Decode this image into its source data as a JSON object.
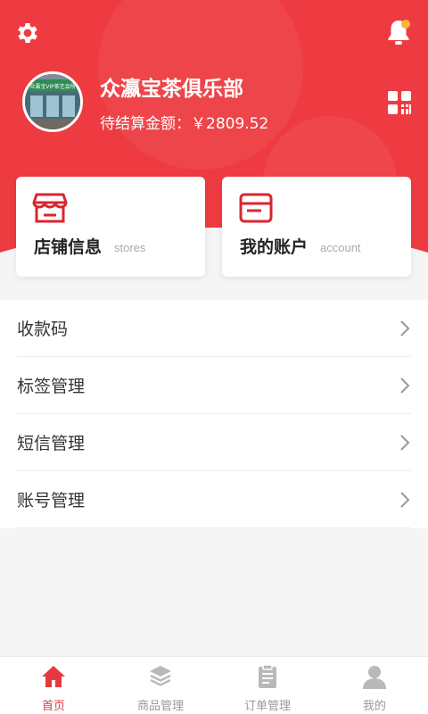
{
  "colors": {
    "brand": "#ee3b41",
    "tab_active": "#e5393f",
    "tab_inactive": "#b9b9b9"
  },
  "header": {
    "store_name": "众瀛宝茶俱乐部",
    "balance": "待结算金额：￥2809.52",
    "avatar_sign_text": "众瀛宝VIP茶艺会所"
  },
  "cards": [
    {
      "title": "店铺信息",
      "subtitle": "stores",
      "icon": "store-icon"
    },
    {
      "title": "我的账户",
      "subtitle": "account",
      "icon": "wallet-icon"
    }
  ],
  "menu": [
    {
      "label": "收款码"
    },
    {
      "label": "标签管理"
    },
    {
      "label": "短信管理"
    },
    {
      "label": "账号管理"
    }
  ],
  "tabs": [
    {
      "label": "首页",
      "icon": "home-icon",
      "active": true
    },
    {
      "label": "商品管理",
      "icon": "layers-icon",
      "active": false
    },
    {
      "label": "订单管理",
      "icon": "clipboard-icon",
      "active": false
    },
    {
      "label": "我的",
      "icon": "user-icon",
      "active": false
    }
  ]
}
